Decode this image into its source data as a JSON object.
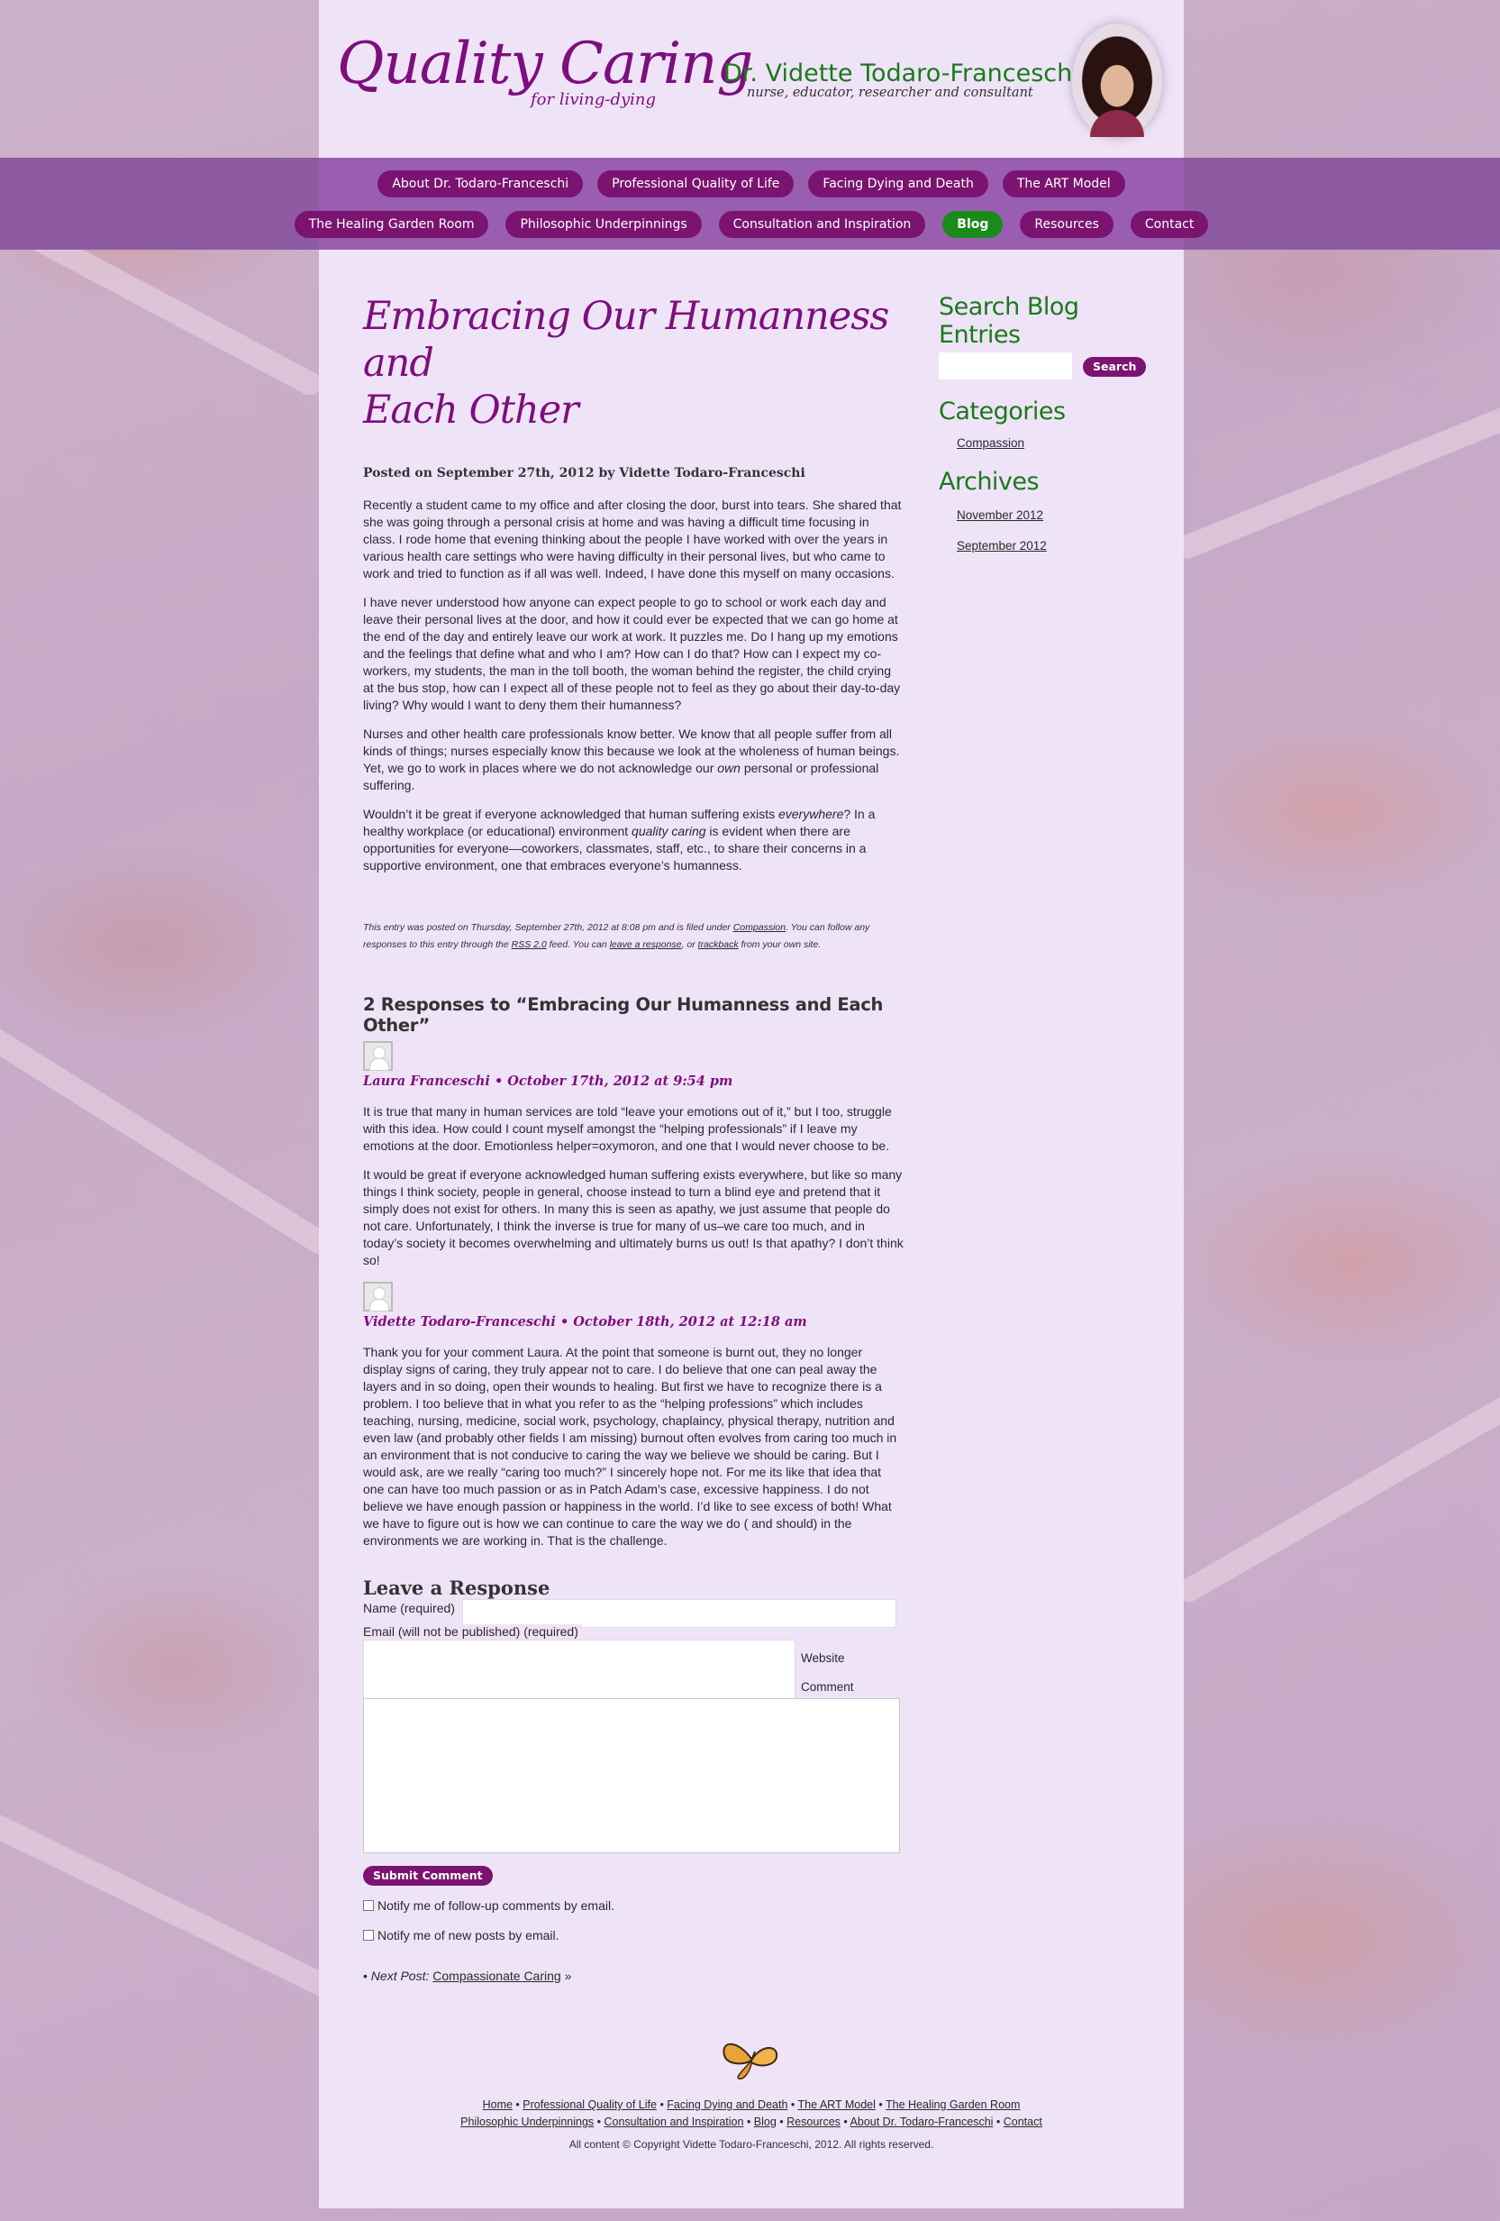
{
  "header": {
    "site_title": "Quality Caring",
    "tagline": "for living-dying",
    "author_name": "Dr. Vidette Todaro-Franceschi",
    "author_role": "nurse, educator, researcher and consultant"
  },
  "nav": {
    "row1": [
      "About Dr. Todaro-Franceschi",
      "Professional Quality of Life",
      "Facing Dying and Death",
      "The ART Model"
    ],
    "row2": [
      "The Healing Garden Room",
      "Philosophic Underpinnings",
      "Consultation and Inspiration",
      "Blog",
      "Resources",
      "Contact"
    ],
    "active": "Blog"
  },
  "post": {
    "title_line1": "Embracing Our Humanness and",
    "title_line2": "Each Other",
    "meta": "Posted on September 27th, 2012 by Vidette Todaro-Franceschi",
    "paragraphs": [
      "Recently a student came to my office and after closing the door, burst into tears.  She shared that she was going through a personal crisis at home and was having a difficult time focusing in class.  I rode home that evening thinking about the people I have worked with over the years in various health care settings who were having difficulty in their personal lives, but who came to work and tried to function as if all was well.  Indeed, I have done this myself on many occasions.",
      "I have never understood how anyone can expect people to go to school or work each day and leave their personal lives at the door, and how it could ever be expected that we can go home at the end of the day and entirely leave our work at work.  It puzzles me.  Do I hang up my emotions and the feelings that define what and who I am?  How can I do that?  How can I expect my co-workers, my students, the man in the toll booth, the woman behind the register, the child crying at the bus stop, how can I expect all of these people not to feel as they go about their day-to-day living? Why would I want to deny them their humanness?"
    ],
    "p3_a": "Nurses and other health care professionals know better. We know that all people suffer from all kinds of things; nurses especially know this because we look at the wholeness of human beings.  Yet, we go to work in places where we do not acknowledge our ",
    "p3_em": "own",
    "p3_b": " personal or professional suffering.",
    "p4_a": "Wouldn’t it be great if everyone acknowledged that human suffering exists ",
    "p4_em1": "everywhere",
    "p4_b": "? In a healthy workplace (or educational) environment ",
    "p4_em2": "quality caring",
    "p4_c": " is evident when there are opportunities for everyone—coworkers, classmates, staff, etc., to share their concerns in a supportive environment, one that embraces everyone’s humanness.",
    "footer_a": "This entry was posted on Thursday, September 27th, 2012 at 8:08 pm and is filed under ",
    "footer_cat": "Compassion",
    "footer_b": ". You can follow any responses to this entry through the ",
    "footer_rss": "RSS 2.0",
    "footer_c": " feed. You can ",
    "footer_leave": "leave a response",
    "footer_d": ", or ",
    "footer_trackback": "trackback",
    "footer_e": " from your own site."
  },
  "responses": {
    "heading": "2 Responses to “Embracing Our Humanness and Each Other”",
    "comments": [
      {
        "head": "Laura Franceschi • October 17th, 2012 at 9:54 pm",
        "paragraphs": [
          "It is true that many in human services are told “leave your emotions out of it,” but I too, struggle with this idea. How could I count myself amongst the “helping professionals” if I leave my emotions at the door. Emotionless helper=oxymoron, and one that I would never choose to be.",
          "It would be great if everyone acknowledged human suffering exists everywhere, but like so many things I think society, people in general, choose instead to turn a blind eye and pretend that it simply does not exist for others. In many this is seen as apathy, we just assume that people do not care. Unfortunately, I think the inverse is true for many of us–we care too much, and in today’s society it becomes overwhelming and ultimately burns us out! Is that apathy? I don’t think so!"
        ]
      },
      {
        "head": "Vidette Todaro-Franceschi • October 18th, 2012 at 12:18 am",
        "paragraphs": [
          "Thank you for your comment Laura. At the point that someone is burnt out, they no longer display signs of caring, they truly appear not to care. I do believe that one can peal away the layers and in so doing, open their wounds to healing. But first we have to recognize there is a problem. I too believe that in what you refer to as the “helping professions” which includes teaching, nursing, medicine, social work, psychology, chaplaincy, physical therapy, nutrition and even law (and probably other fields I am missing) burnout often evolves from caring too much in an environment that is not conducive to caring the way we believe we should be caring. But I would ask, are we really “caring too much?” I sincerely hope not. For me its like that idea that one can have too much passion or as in Patch Adam’s case, excessive happiness. I do not believe we have enough passion or happiness in the world. I’d like to see excess of both! What we have to figure out is how we can continue to care the way we do ( and should) in the environments we are working in. That is the challenge."
        ]
      }
    ]
  },
  "form": {
    "heading": "Leave a Response",
    "name_label": "Name (required)",
    "email_label": "Email (will not be published) (required)",
    "website_label": "Website",
    "comment_label": "Comment",
    "submit_label": "Submit Comment",
    "notify_followup": "Notify me of follow-up comments by email.",
    "notify_posts": "Notify me of new posts by email."
  },
  "next_post": {
    "prefix": "• ",
    "label": "Next Post:",
    "title": "Compassionate Caring",
    "suffix": " »"
  },
  "sidebar": {
    "search_heading": "Search Blog Entries",
    "search_button": "Search",
    "categories_heading": "Categories",
    "categories": [
      "Compassion"
    ],
    "archives_heading": "Archives",
    "archives": [
      "November 2012",
      "September 2012"
    ]
  },
  "footer": {
    "row1": [
      "Home",
      "Professional Quality of Life",
      "Facing Dying and Death",
      "The ART Model",
      "The Healing Garden Room"
    ],
    "row2": [
      "Philosophic Underpinnings",
      "Consultation and Inspiration",
      "Blog",
      "Resources",
      "About Dr. Todaro-Franceschi",
      "Contact"
    ],
    "separator": " • ",
    "copyright": "All content © Copyright Vidette Todaro-Franceschi, 2012. All rights reserved."
  },
  "colors": {
    "brand_purple": "#7d0f7d",
    "nav_pill": "#7a1470",
    "active_green": "#1a8a1a",
    "heading_green": "#1a7a1a",
    "page_bg": "#efe3f8"
  }
}
